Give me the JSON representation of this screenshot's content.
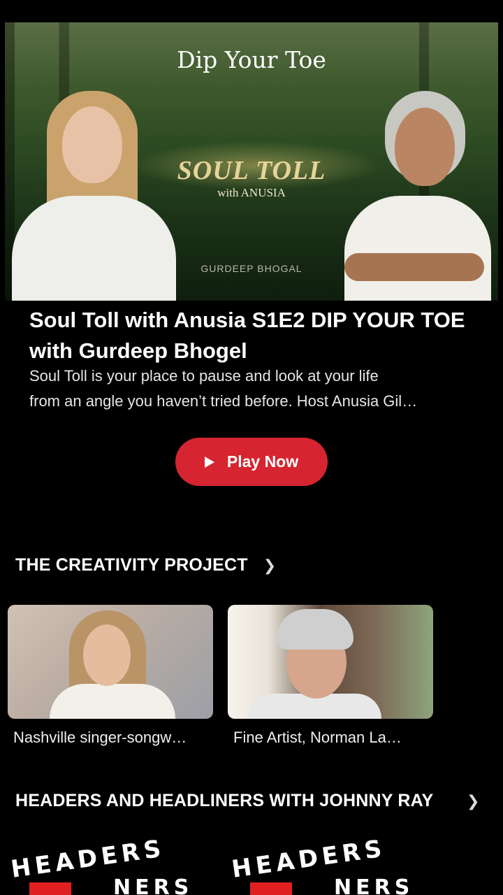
{
  "hero": {
    "banner_title": "Dip Your Toe",
    "show_name": "SOUL TOLL",
    "show_with": "with ANUSIA",
    "guest_name": "GURDEEP BHOGAL"
  },
  "episode": {
    "title": "Soul Toll with Anusia S1E2 DIP YOUR TOE with Gurdeep Bhogel",
    "description_line1": "Soul Toll is your place to pause and look at your life",
    "description_line2": "from an angle you haven’t tried before. Host Anusia Gil…",
    "play_label": "Play Now",
    "play_icon": "play-icon"
  },
  "sections": [
    {
      "title": "THE CREATIVITY PROJECT",
      "icon": "chevron-right-icon",
      "items": [
        {
          "caption": "Nashville singer-songw…"
        },
        {
          "caption": "Fine Artist, Norman La…"
        }
      ]
    },
    {
      "title": "HEADERS AND HEADLINERS WITH JOHNNY RAY",
      "icon": "chevron-right-icon",
      "items": [
        {
          "logo_text": "HEADERS",
          "logo_text2": "NERS"
        },
        {
          "logo_text": "HEADERS",
          "logo_text2": "NERS"
        }
      ]
    }
  ],
  "colors": {
    "background": "#000000",
    "accent": "#d62531",
    "text": "#ffffff"
  }
}
